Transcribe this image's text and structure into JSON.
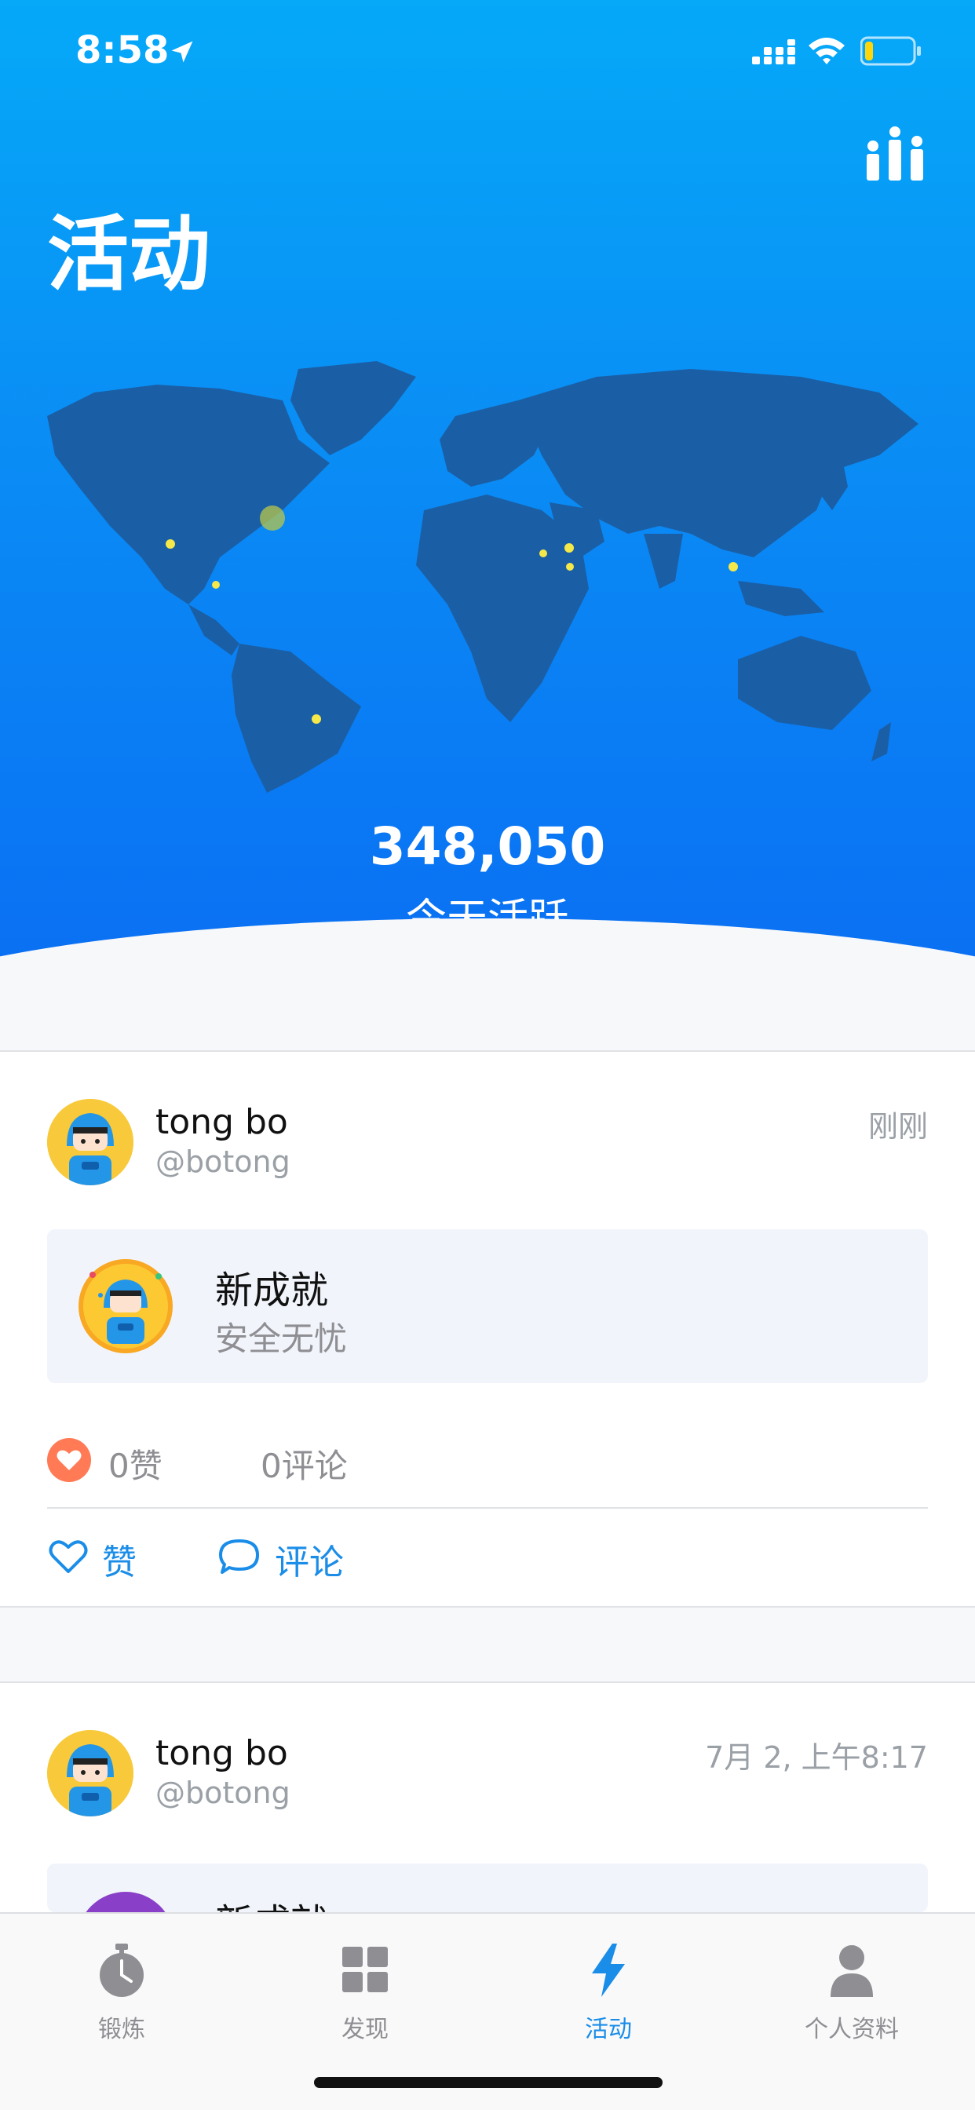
{
  "status_bar": {
    "time": "8:58"
  },
  "page": {
    "title": "活动"
  },
  "activity": {
    "count": "348,050",
    "label": "今天活跃"
  },
  "feed": [
    {
      "user_name": "tong bo",
      "user_handle": "@botong",
      "time": "刚刚",
      "achievement_title": "新成就",
      "achievement_subtitle": "安全无忧",
      "likes": "0赞",
      "comments": "0评论",
      "like_action": "赞",
      "comment_action": "评论"
    },
    {
      "user_name": "tong bo",
      "user_handle": "@botong",
      "time": "7月 2, 上午8:17",
      "achievement_title": "新成就"
    }
  ],
  "tabs": [
    {
      "label": "锻炼",
      "icon": "stopwatch-icon",
      "active": false
    },
    {
      "label": "发现",
      "icon": "grid-icon",
      "active": false
    },
    {
      "label": "活动",
      "icon": "lightning-icon",
      "active": true
    },
    {
      "label": "个人资料",
      "icon": "person-icon",
      "active": false
    }
  ],
  "colors": {
    "header_gradient_top": "#05a9f8",
    "header_gradient_bottom": "#0a6ff3",
    "accent": "#1a8de8",
    "heart": "#ff7a55",
    "map": "#1a5fa6",
    "map_dot": "#f5e84a"
  }
}
